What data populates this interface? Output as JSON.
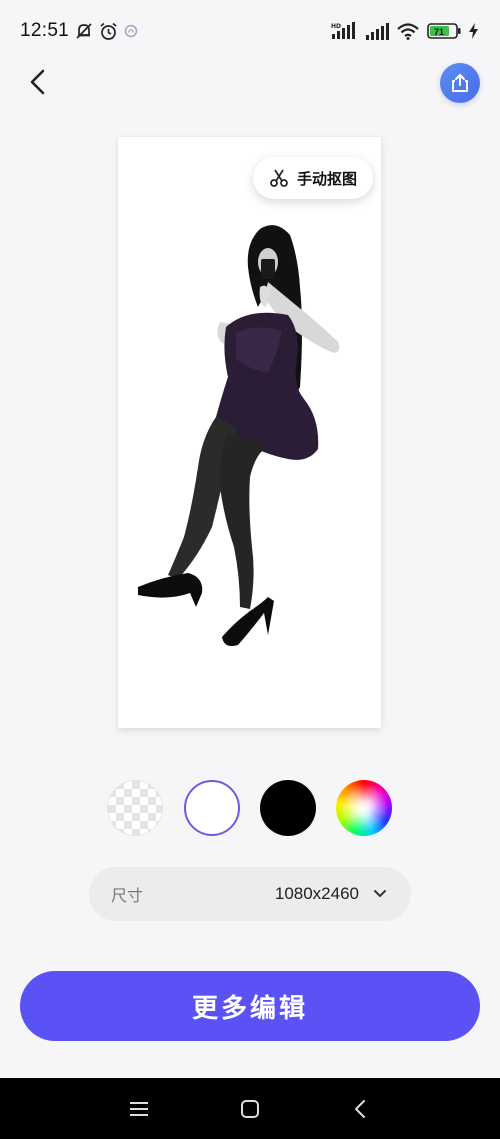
{
  "status_bar": {
    "time": "12:51",
    "battery_level": "71",
    "network_badge": "HD",
    "icons": [
      "mute-bell-icon",
      "alarm-icon",
      "app-notification-icon",
      "cellular-signal-icon",
      "wifi-icon",
      "battery-icon",
      "charging-icon"
    ]
  },
  "toolbar": {
    "back_icon": "chevron-left-icon",
    "share_icon": "share-icon"
  },
  "canvas": {
    "manual_cutout_label": "手动抠图",
    "manual_cutout_icon": "scissors-icon"
  },
  "backgrounds": {
    "options": [
      {
        "name": "transparent",
        "selected": false
      },
      {
        "name": "white",
        "color": "#ffffff",
        "selected": true
      },
      {
        "name": "black",
        "color": "#000000",
        "selected": false
      },
      {
        "name": "custom-color",
        "selected": false
      }
    ],
    "selected_ring_color": "#6c5ce0"
  },
  "size": {
    "label": "尺寸",
    "value": "1080x2460"
  },
  "actions": {
    "more_edit_label": "更多编辑",
    "primary_color": "#5a52f5"
  },
  "navigation": {
    "icons": [
      "menu-icon",
      "home-icon",
      "back-icon"
    ]
  }
}
